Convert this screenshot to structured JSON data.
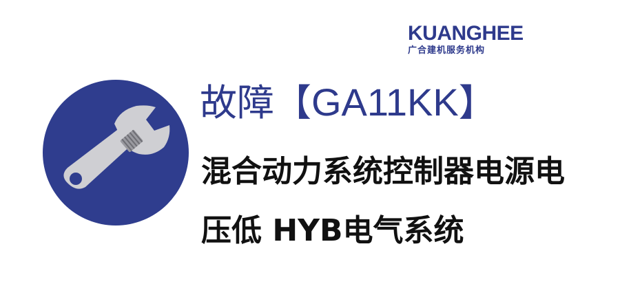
{
  "brand": {
    "name": "KUANGHEE",
    "tagline": "广合建机服务机构"
  },
  "fault": {
    "label": "故障",
    "bracket_open": "【",
    "code": "GA11KK",
    "bracket_close": "】"
  },
  "description": {
    "line1": "混合动力系统控制器电源电",
    "line2": "压低 HYB电气系统"
  },
  "icon": "wrench-icon",
  "colors": {
    "brand_blue": "#2e3a8c",
    "circle_blue": "#2f3d8e",
    "wrench_gray": "#cfcfd3",
    "text_black": "#111111"
  }
}
